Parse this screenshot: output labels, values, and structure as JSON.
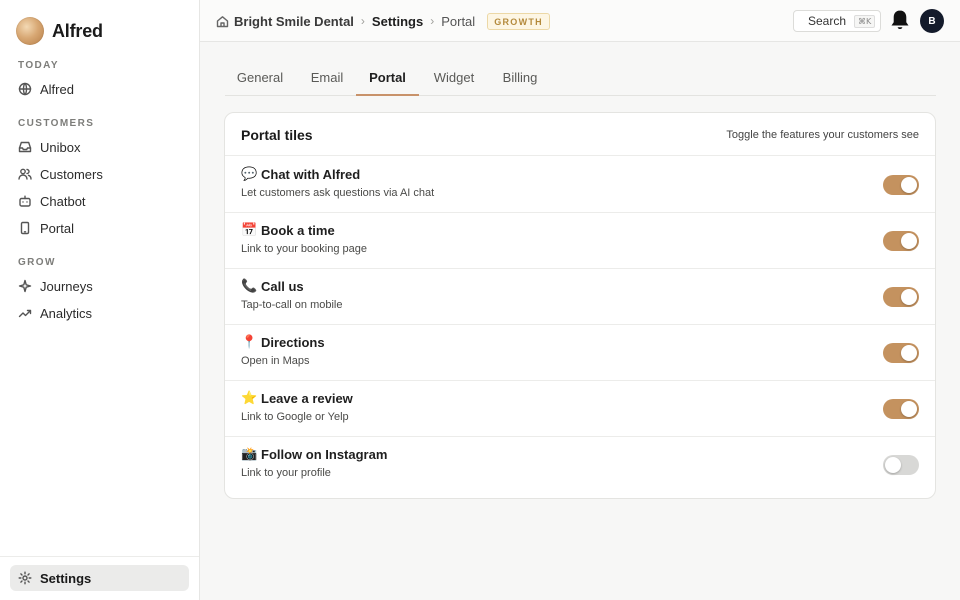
{
  "app": {
    "name": "Alfred"
  },
  "sidebar": {
    "sections": [
      {
        "label": "TODAY",
        "items": [
          {
            "label": "Alfred",
            "icon": "globe-icon"
          }
        ]
      },
      {
        "label": "CUSTOMERS",
        "items": [
          {
            "label": "Unibox",
            "icon": "inbox-icon"
          },
          {
            "label": "Customers",
            "icon": "users-icon"
          },
          {
            "label": "Chatbot",
            "icon": "bot-icon"
          },
          {
            "label": "Portal",
            "icon": "phone-icon"
          }
        ]
      },
      {
        "label": "GROW",
        "items": [
          {
            "label": "Journeys",
            "icon": "sparkle-icon"
          },
          {
            "label": "Analytics",
            "icon": "trend-icon"
          }
        ]
      }
    ],
    "footer": {
      "label": "Settings",
      "icon": "gear-icon",
      "active": true
    }
  },
  "topbar": {
    "breadcrumb": [
      "Bright Smile Dental",
      "Settings",
      "Portal"
    ],
    "plan_badge": "GROWTH",
    "search_label": "Search",
    "search_shortcut": "⌘K",
    "avatar_initial": "B"
  },
  "tabs": [
    {
      "label": "General",
      "active": false
    },
    {
      "label": "Email",
      "active": false
    },
    {
      "label": "Portal",
      "active": true
    },
    {
      "label": "Widget",
      "active": false
    },
    {
      "label": "Billing",
      "active": false
    }
  ],
  "card": {
    "title": "Portal tiles",
    "hint": "Toggle the features your customers see",
    "rows": [
      {
        "emoji": "💬",
        "title": "Chat with Alfred",
        "desc": "Let customers ask questions via AI chat",
        "enabled": true
      },
      {
        "emoji": "📅",
        "title": "Book a time",
        "desc": "Link to your booking page",
        "enabled": true
      },
      {
        "emoji": "📞",
        "title": "Call us",
        "desc": "Tap-to-call on mobile",
        "enabled": true
      },
      {
        "emoji": "📍",
        "title": "Directions",
        "desc": "Open in Maps",
        "enabled": true
      },
      {
        "emoji": "⭐",
        "title": "Leave a review",
        "desc": "Link to Google or Yelp",
        "enabled": true
      },
      {
        "emoji": "📸",
        "title": "Follow on Instagram",
        "desc": "Link to your profile",
        "enabled": false
      }
    ]
  },
  "colors": {
    "accent": "#c4925f",
    "badge_text": "#b48a3c",
    "avatar_bg": "#141b2b"
  }
}
